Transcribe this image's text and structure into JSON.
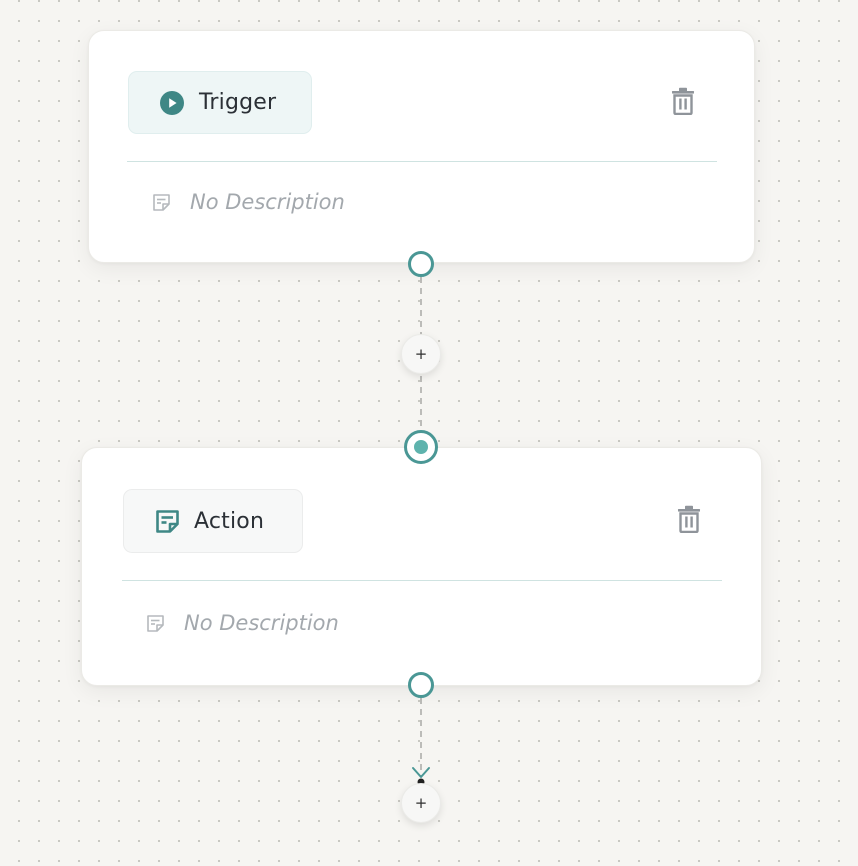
{
  "colors": {
    "accent": "#3e8785",
    "handle_border": "#4a9795",
    "handle_fill_active": "#5eb3ad",
    "muted_text": "#a3a8ad",
    "icon_gray": "#8f949a",
    "canvas_bg": "#f6f5f2"
  },
  "nodes": [
    {
      "type_label": "Trigger",
      "type_icon": "play-circle-icon",
      "description": "No Description",
      "description_icon": "note-icon",
      "delete_icon": "trash-icon"
    },
    {
      "type_label": "Action",
      "type_icon": "note-icon",
      "description": "No Description",
      "description_icon": "note-icon",
      "delete_icon": "trash-icon"
    }
  ],
  "add_step_buttons": [
    {
      "label": "+"
    },
    {
      "label": "+"
    }
  ]
}
